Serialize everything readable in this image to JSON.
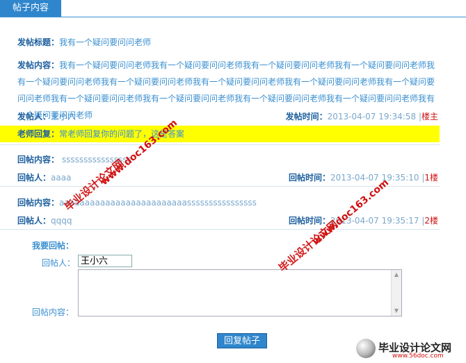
{
  "tab": {
    "label": "帖子内容"
  },
  "post": {
    "title_label": "发帖标题：",
    "title_value": "我有一个疑问要问问老师",
    "content_label": "发帖内容：",
    "content_value": "我有一个疑问要问问老师我有一个疑问要问问老师我有一个疑问要问问老师我有一个疑问要问问老师我有一个疑问要问问老师我有一个疑问要问问老师我有一个疑问要问问老师我有一个疑问要问问老师我有一个疑问要问问老师我有一个疑问要问问老师我有一个疑问要问问老师我有一个疑问要问问老师我有一个疑问要问问老师我有一个疑问要问问老师",
    "author_label": "发帖人：",
    "author_value": "王小六",
    "time_label": "发帖时间：",
    "time_value": "2013-04-07 19:34:58",
    "sep": "|",
    "floor": "楼主",
    "teacher_label": "老师回复：",
    "teacher_value": "常老师回复你的问题了，这是答案"
  },
  "replies": [
    {
      "content_label": "回帖内容：",
      "content_value": "ssssssssssssssss",
      "author_label": "回帖人：",
      "author_value": "aaaa",
      "time_label": "回帖时间：",
      "time_value": "2013-04-07 19:35:10",
      "sep": "|",
      "floor": "1楼"
    },
    {
      "content_label": "回帖内容：",
      "content_value": "aaaaaaaaaaaaaaaaaaaaaaaaassssssssssssssss",
      "author_label": "回帖人：",
      "author_value": "qqqq",
      "time_label": "回帖时间：",
      "time_value": "2013-04-07 19:35:17",
      "sep": "|",
      "floor": "2楼"
    }
  ],
  "form": {
    "heading": "我要回帖：",
    "author_label": "回帖人：",
    "author_value": "王小六",
    "content_label": "回帖内容：",
    "submit_label": "回复帖子"
  },
  "watermarks": {
    "a_cn": "毕业设计论文网",
    "a_url": "www.doc163.com",
    "logo_cn": "毕业设计论文网",
    "logo_url": "www.56doc.com"
  }
}
